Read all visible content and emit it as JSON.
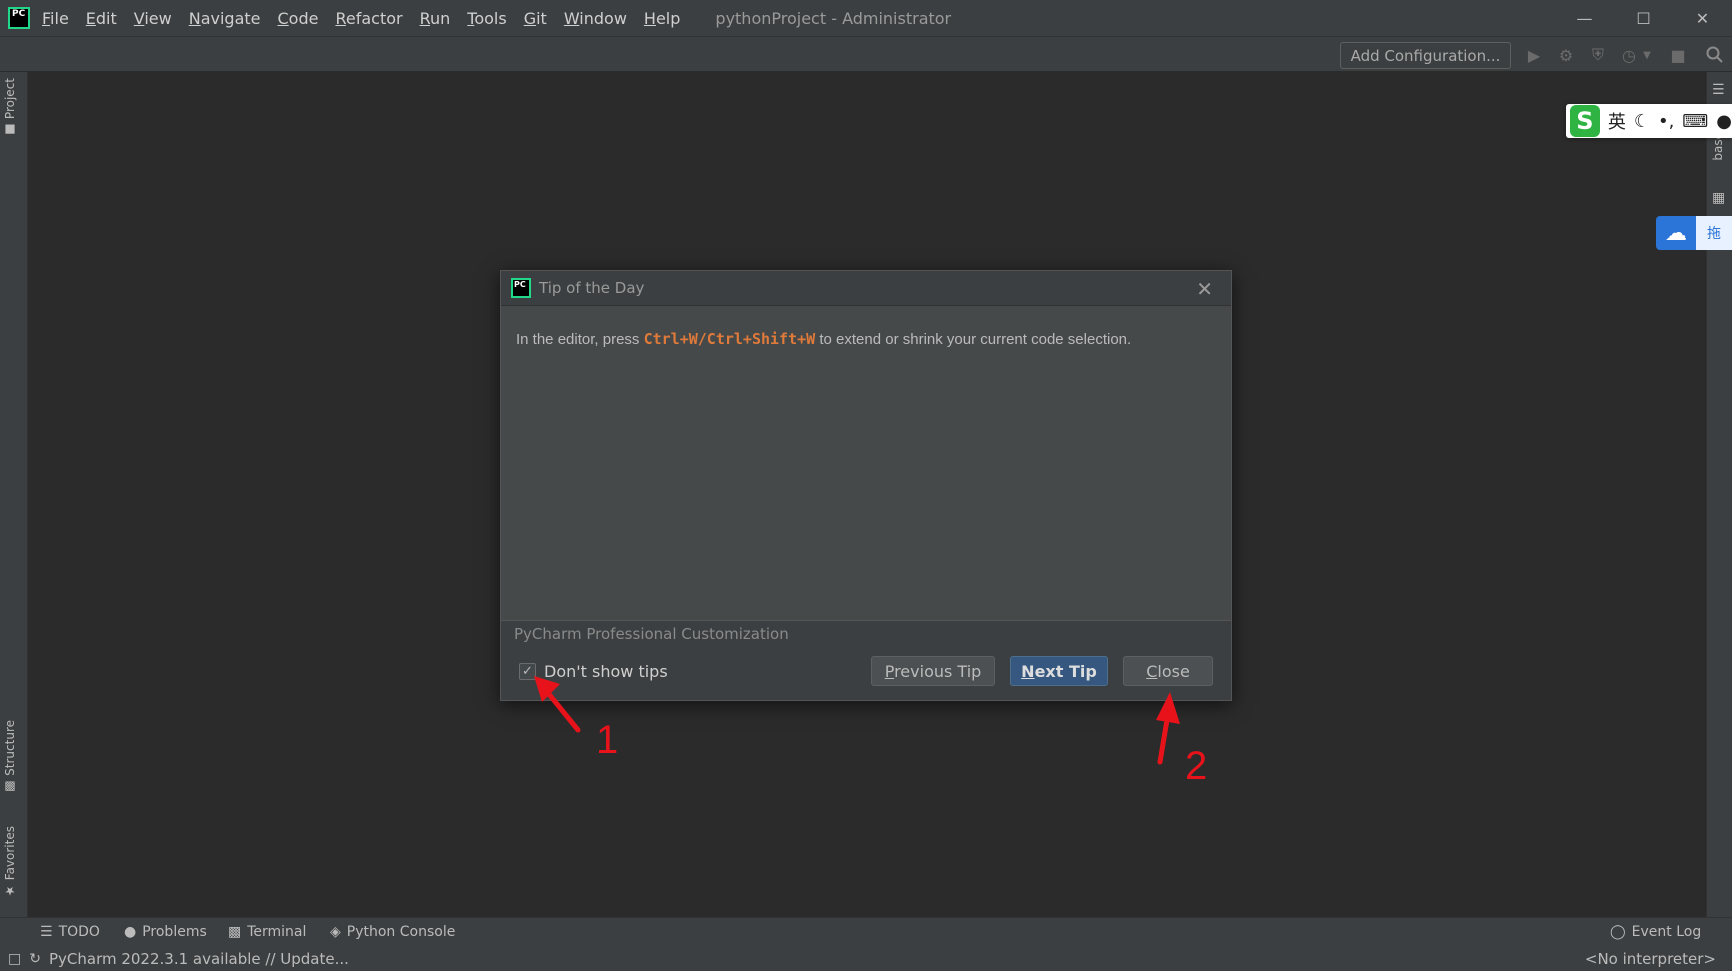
{
  "app": {
    "logo_text": "PC",
    "window_title": "pythonProject - Administrator"
  },
  "menu": [
    "File",
    "Edit",
    "View",
    "Navigate",
    "Code",
    "Refactor",
    "Run",
    "Tools",
    "Git",
    "Window",
    "Help"
  ],
  "toolbar": {
    "add_configuration": "Add Configuration..."
  },
  "left_tabs": {
    "project": "Project",
    "structure": "Structure",
    "favorites": "Favorites"
  },
  "right_tabs": {
    "database_fragment": "base"
  },
  "dialog": {
    "title": "Tip of the Day",
    "tip_prefix": "In the editor, press ",
    "shortcut1": "Ctrl+W",
    "separator": "/",
    "shortcut2": "Ctrl+Shift+W",
    "tip_suffix": " to extend or shrink your current code selection.",
    "footer_label": "PyCharm Professional Customization",
    "dont_show_label": "Don't show tips",
    "dont_show_checked": true,
    "previous_tip": "Previous Tip",
    "next_tip": "Next Tip",
    "close": "Close"
  },
  "bottom_tabs": {
    "todo": "TODO",
    "problems": "Problems",
    "terminal": "Terminal",
    "python_console": "Python Console",
    "event_log": "Event Log"
  },
  "status_bar": {
    "update_message": "PyCharm 2022.3.1 available // Update...",
    "interpreter": "<No interpreter>"
  },
  "ime": {
    "logo": "S",
    "mode": "英"
  },
  "cloud": {
    "label": "拖"
  },
  "annotations": {
    "label_1": "1",
    "label_2": "2",
    "color": "#e8131a"
  },
  "colors": {
    "accent_blue": "#365880",
    "shortcut_orange": "#e07a3a",
    "logo_green": "#21d789"
  }
}
